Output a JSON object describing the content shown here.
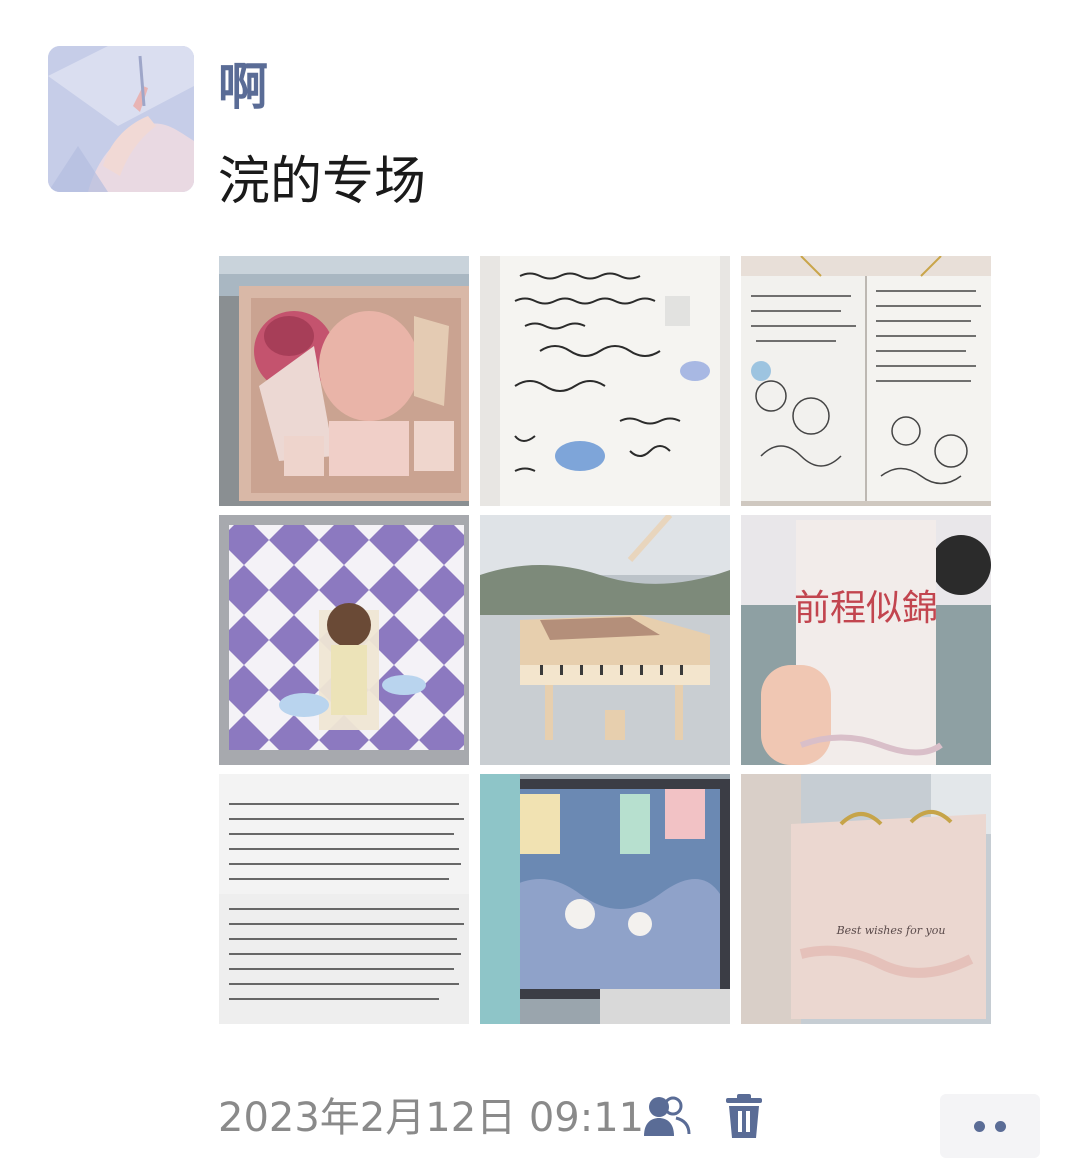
{
  "post": {
    "username": "啊",
    "text": "浣的专场",
    "timestamp": "2023年2月12日 09:11"
  },
  "photos": [
    {
      "name": "photo-gift-box-flowers",
      "accent": "#d98a99"
    },
    {
      "name": "photo-handwritten-card",
      "accent": "#6f8fd9"
    },
    {
      "name": "photo-doodle-notebook",
      "accent": "#8b8b8b"
    },
    {
      "name": "photo-wrapped-gift-checkered",
      "accent": "#8c79c0"
    },
    {
      "name": "photo-piano-music-box",
      "accent": "#e9d2b4"
    },
    {
      "name": "photo-card-in-hand",
      "accent": "#c2454f"
    },
    {
      "name": "photo-handwritten-letter",
      "accent": "#3c3c3c"
    },
    {
      "name": "photo-puzzle-frame",
      "accent": "#5a7fa8"
    },
    {
      "name": "photo-gift-bag",
      "accent": "#e6c7c4"
    }
  ],
  "photo_texts": {
    "card_text": "前程似錦",
    "bag_text": "Best wishes for you"
  },
  "icons": {
    "visibility": "people-icon",
    "delete": "trash-icon",
    "more": "more-dots-icon"
  },
  "colors": {
    "username": "#5a6c96",
    "timestamp": "#8a8a8a",
    "icon": "#5a6c96",
    "more_bg": "#f4f4f6"
  }
}
